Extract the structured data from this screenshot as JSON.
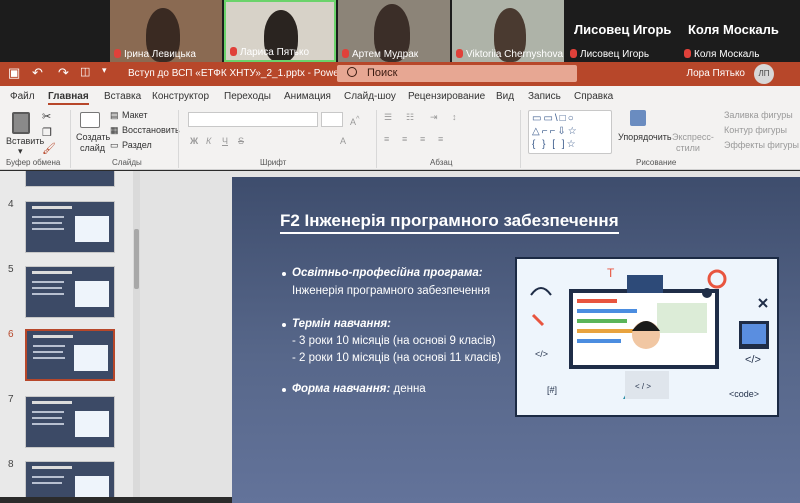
{
  "participants": [
    {
      "name": "Ірина Левицька"
    },
    {
      "name": "Лариса Пятько"
    },
    {
      "name": "Артем Мудрак"
    },
    {
      "name": "Viktoriia Chernyshova"
    },
    {
      "name": "Лисовец Игорь",
      "large_name": "Лисовец Игорь"
    },
    {
      "name": "Коля Москаль",
      "large_name": "Коля Москаль"
    }
  ],
  "titlebar": {
    "filename": "Вступ до ВСП «ЕТФК ХНТУ»_2_1.pptx",
    "app": "PowerPoint",
    "separator": " - ",
    "search_placeholder": "Поиск",
    "user": "Лора Пятько",
    "initials": "ЛП"
  },
  "menu": [
    "Файл",
    "Главная",
    "Вставка",
    "Конструктор",
    "Переходы",
    "Анимация",
    "Слайд-шоу",
    "Рецензирование",
    "Вид",
    "Запись",
    "Справка"
  ],
  "ribbon": {
    "paste": "Вставить",
    "clipboard_group": "Буфер обмена",
    "new_slide_1": "Создать",
    "new_slide_2": "слайд",
    "layout": "Макет",
    "reset": "Восстановить",
    "section": "Раздел",
    "slides_group": "Слайды",
    "font_group": "Шрифт",
    "paragraph_group": "Абзац",
    "arrange_1": "Упорядочить",
    "quick_styles_1": "Экспресс-",
    "quick_styles_2": "стили",
    "shape_fill": "Заливка фигуры",
    "shape_outline": "Контур фигуры",
    "shape_effects": "Эффекты фигуры",
    "drawing_group": "Рисование",
    "bold": "Ж",
    "italic": "К",
    "underline": "Ч",
    "strike": "S",
    "font_a": "A"
  },
  "thumbnails": [
    {
      "num": "4"
    },
    {
      "num": "5"
    },
    {
      "num": "6"
    },
    {
      "num": "7"
    },
    {
      "num": "8"
    }
  ],
  "slide": {
    "title": "F2 Інженерія програмного забезпечення",
    "prog_label": "Освітньо-професійна програма:",
    "prog_value": "Інженерія програмного забезпечення",
    "term_label": "Термін навчання:",
    "term_1": "- 3 роки 10 місяців (на основі 9 класів)",
    "term_2": "- 2 роки 10 місяців (на основі 11 класів)",
    "form_label": "Форма навчання:",
    "form_value": " денна"
  },
  "illustration": {
    "code_left": "</>",
    "code_right": "</>",
    "code_tag": "<code>",
    "hash": "[#]",
    "laptop": "< / >"
  },
  "colors": {
    "accent": "#b7472a",
    "slide_bg": "#4a5a7c"
  }
}
